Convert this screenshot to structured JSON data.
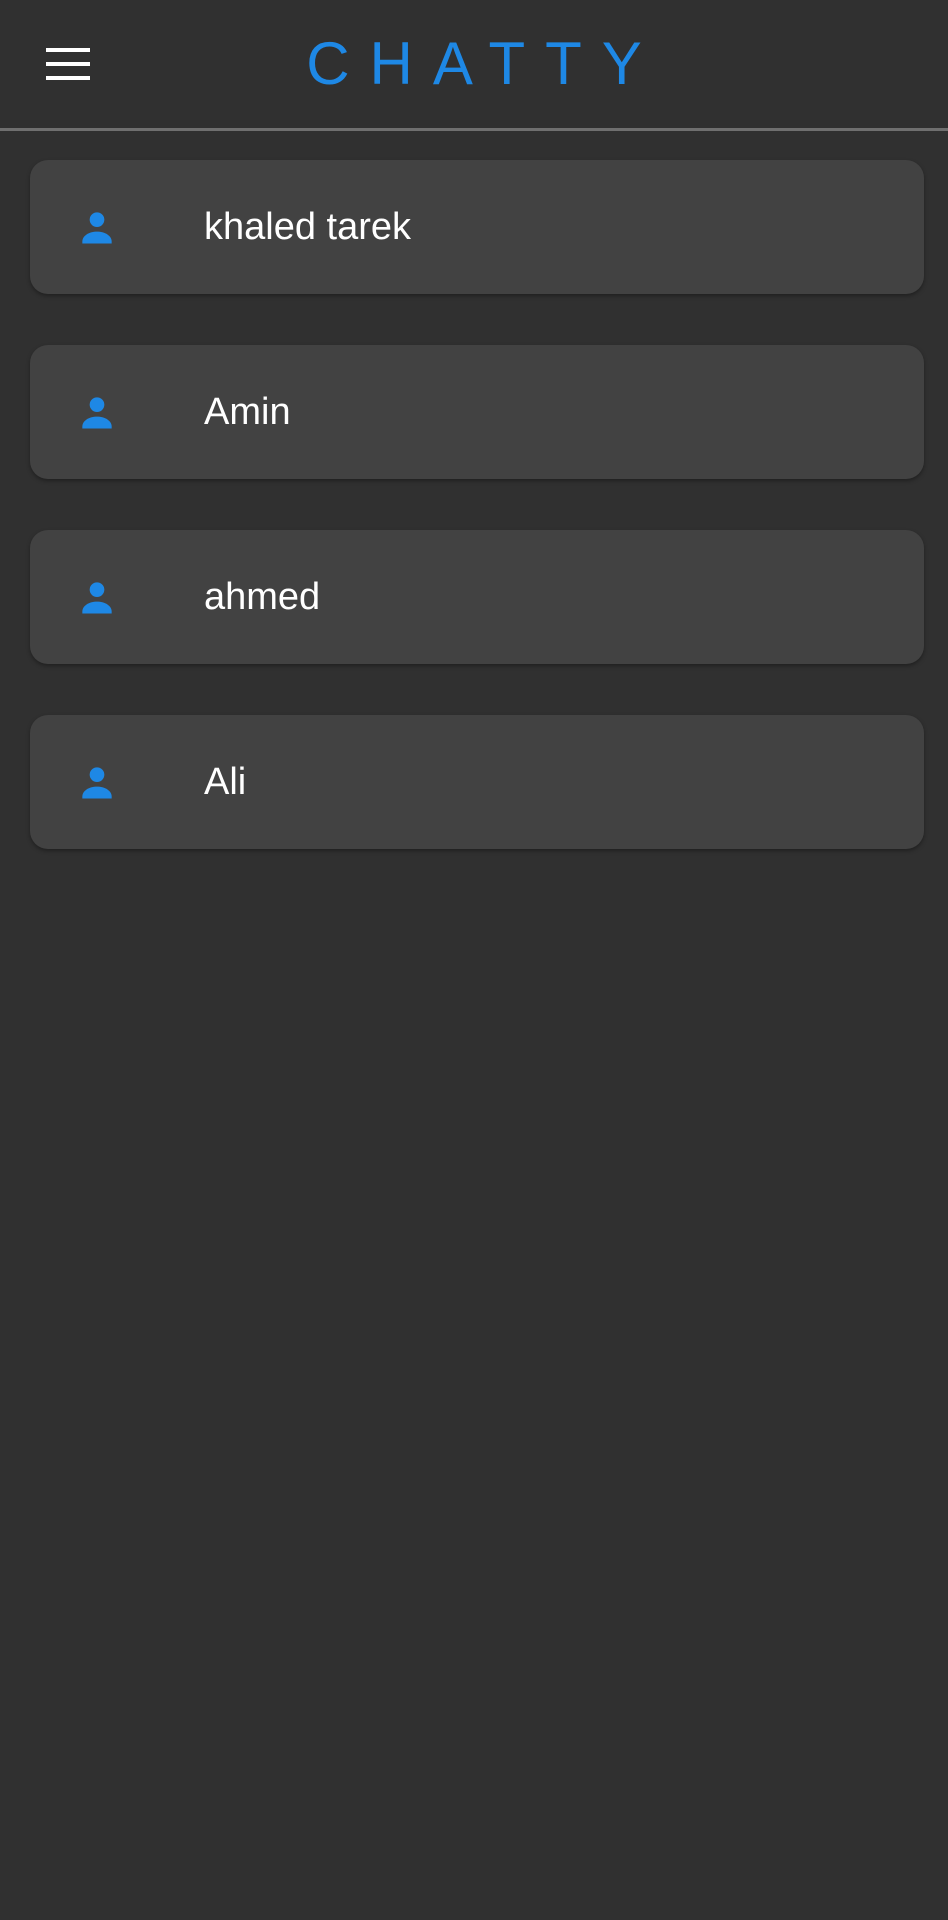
{
  "app_bar": {
    "title": "CHATTY",
    "menu_icon": "hamburger-menu-icon",
    "accent_color": "#1e88e5"
  },
  "users": [
    {
      "name": "khaled tarek",
      "icon": "person-icon"
    },
    {
      "name": "Amin",
      "icon": "person-icon"
    },
    {
      "name": "ahmed",
      "icon": "person-icon"
    },
    {
      "name": "Ali",
      "icon": "person-icon"
    }
  ],
  "colors": {
    "background": "#303030",
    "card": "#424242",
    "text": "#ffffff",
    "divider": "#6f6f6f"
  }
}
